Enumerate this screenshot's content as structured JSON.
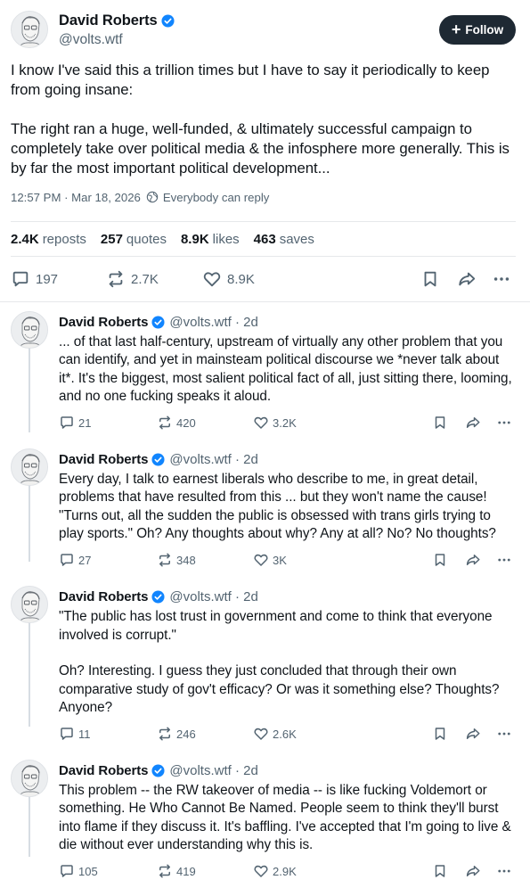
{
  "post": {
    "author": {
      "name": "David Roberts",
      "handle": "@volts.wtf"
    },
    "follow_label": "Follow",
    "text": "I know I've said this a trillion times but I have to say it periodically to keep from going insane:\n\nThe right ran a huge, well-funded, & ultimately successful campaign to completely take over political media & the infosphere more generally. This is by far the most important political development...",
    "timestamp": "12:57 PM · Mar 18, 2026",
    "reply_setting": "Everybody can reply",
    "stats": {
      "reposts_value": "2.4K",
      "reposts_label": "reposts",
      "quotes_value": "257",
      "quotes_label": "quotes",
      "likes_value": "8.9K",
      "likes_label": "likes",
      "saves_value": "463",
      "saves_label": "saves"
    },
    "actions": {
      "replies": "197",
      "reposts": "2.7K",
      "likes": "8.9K"
    }
  },
  "replies": [
    {
      "name": "David Roberts",
      "handle": "@volts.wtf · 2d",
      "text": "... of that last half-century, upstream of virtually any other problem that you can identify, and yet in mainsteam political discourse we *never talk about it*. It's the biggest, most salient political fact of all, just sitting there, looming, and no one fucking speaks it aloud.",
      "replies": "21",
      "reposts": "420",
      "likes": "3.2K"
    },
    {
      "name": "David Roberts",
      "handle": "@volts.wtf · 2d",
      "text": "Every day, I talk to earnest liberals who describe to me, in great detail, problems that have resulted from this ... but they won't name the cause! \"Turns out, all the sudden the public is obsessed with trans girls trying to play sports.\" Oh? Any thoughts about why? Any at all? No? No thoughts?",
      "replies": "27",
      "reposts": "348",
      "likes": "3K"
    },
    {
      "name": "David Roberts",
      "handle": "@volts.wtf · 2d",
      "text": "\"The public has lost trust in government and come to think that everyone involved is corrupt.\"\n\nOh? Interesting. I guess they just concluded that through their own comparative study of gov't efficacy? Or was it something else? Thoughts? Anyone?",
      "replies": "11",
      "reposts": "246",
      "likes": "2.6K"
    },
    {
      "name": "David Roberts",
      "handle": "@volts.wtf · 2d",
      "text": "This problem -- the RW takeover of media -- is like fucking Voldemort or something. He Who Cannot Be Named. People seem to think they'll burst into flame if they discuss it. It's baffling. I've accepted that I'm going to live & die without ever understanding why this is.",
      "replies": "105",
      "reposts": "419",
      "likes": "2.9K"
    }
  ]
}
